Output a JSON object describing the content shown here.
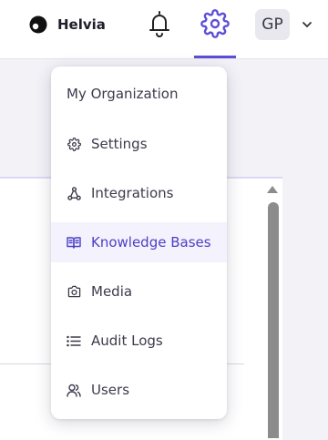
{
  "header": {
    "brand_name": "Helvia",
    "avatar_initials": "GP",
    "accent_color": "#5b4fd6"
  },
  "menu": {
    "title": "My Organization",
    "active_item": "Knowledge Bases",
    "items": [
      {
        "label": "Settings",
        "icon": "gear-icon"
      },
      {
        "label": "Integrations",
        "icon": "integrations-icon"
      },
      {
        "label": "Knowledge Bases",
        "icon": "book-icon"
      },
      {
        "label": "Media",
        "icon": "camera-icon"
      },
      {
        "label": "Audit Logs",
        "icon": "list-icon"
      },
      {
        "label": "Users",
        "icon": "users-icon"
      }
    ]
  }
}
